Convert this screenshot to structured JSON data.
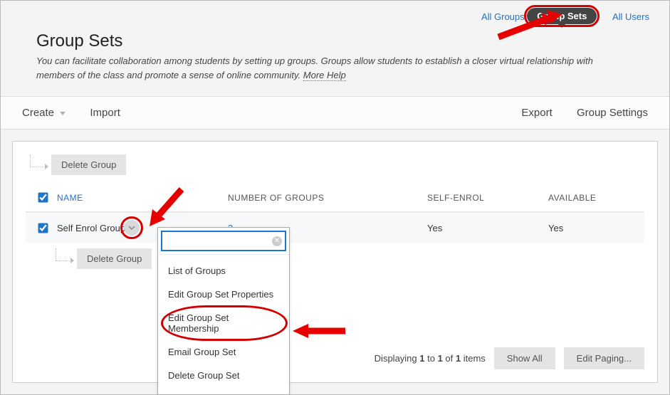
{
  "tabs": {
    "all_groups": "All Groups",
    "group_sets": "Group Sets",
    "all_users": "All Users"
  },
  "page": {
    "title": "Group Sets",
    "description_1": "You can facilitate collaboration among students by setting up groups. Groups allow students to establish a closer virtual relationship with members of the class and promote a sense of online community. ",
    "more_help": "More Help"
  },
  "toolbar": {
    "create": "Create",
    "import": "Import",
    "export": "Export",
    "settings": "Group Settings"
  },
  "buttons": {
    "delete_group": "Delete Group",
    "show_all": "Show All",
    "edit_paging": "Edit Paging..."
  },
  "columns": {
    "name": "NAME",
    "num": "NUMBER OF GROUPS",
    "self": "SELF-ENROL",
    "avail": "AVAILABLE"
  },
  "rows": [
    {
      "name": "Self Enrol Group",
      "num": "3",
      "self": "Yes",
      "avail": "Yes"
    }
  ],
  "menu": {
    "search_placeholder": "",
    "items": {
      "list": "List of Groups",
      "edit_props": "Edit Group Set Properties",
      "edit_membership": "Edit Group Set Membership",
      "email": "Email Group Set",
      "delete": "Delete Group Set"
    }
  },
  "pager": {
    "prefix": "Displaying ",
    "a": "1",
    "mid1": " to ",
    "b": "1",
    "mid2": " of ",
    "c": "1",
    "suffix": " items"
  }
}
